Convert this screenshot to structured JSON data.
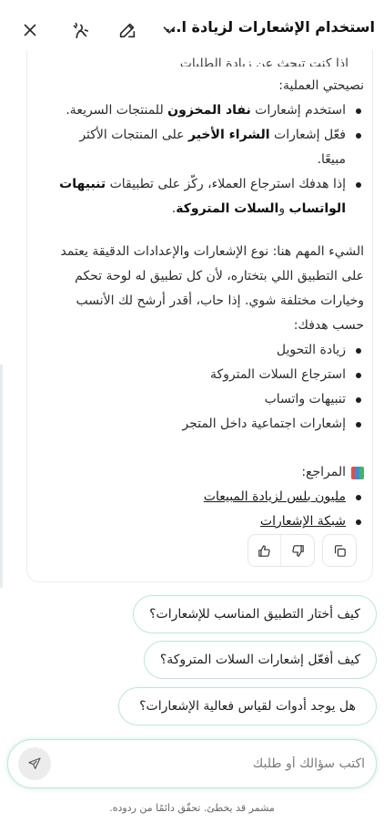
{
  "header": {
    "title": "استخدام الإشعارات لزيادة ا...",
    "icons": [
      "chevron-down-icon",
      "edit-icon",
      "fx-icon",
      "close-icon"
    ]
  },
  "answer": {
    "partial_line": "إذا كنت تبحث عن زيادة الطلبات الأولى",
    "tip_heading": "نصيحتي العملية:",
    "tips": [
      {
        "pre": "استخدم إشعارات ",
        "bold": "نفاد المخزون",
        "post": " للمنتجات السريعة."
      },
      {
        "pre": "فعّل إشعارات ",
        "bold": "الشراء الأخير",
        "post": " على المنتجات الأكثر مبيعًا."
      },
      {
        "pre": "إذا هدفك استرجاع العملاء، ركّز على تطبيقات ",
        "bold": "تنبيهات الواتساب",
        "mid": " و",
        "bold2": "السلات المتروكة",
        "post": "."
      }
    ],
    "important_paragraph": "الشيء المهم هنا: نوع الإشعارات والإعدادات الدقيقة يعتمد على التطبيق اللي بتختاره، لأن كل تطبيق له لوحة تحكم وخيارات مختلفة شوي. إذا حاب، أقدر أرشح لك الأنسب حسب هدفك:",
    "goals": [
      "زيادة التحويل",
      "استرجاع السلات المتروكة",
      "تنبيهات واتساب",
      "إشعارات اجتماعية داخل المتجر"
    ],
    "references_title": "المراجع:",
    "references": [
      "مليون بلس لزيادة المبيعات",
      "شبكة الإشعارات"
    ]
  },
  "suggestions": [
    "كيف أختار التطبيق المناسب للإشعارات؟",
    "كيف أفعّل إشعارات السلات المتروكة؟",
    "هل يوجد أدوات لقياس فعالية الإشعارات؟"
  ],
  "input": {
    "placeholder": "اكتب سؤالك أو طلبك"
  },
  "disclaimer": "مشمر قد يخطئ. تحقّق دائمًا من ردوده.",
  "colors": {
    "accent_border": "#bfe6d6",
    "text": "#1f1f1f"
  }
}
